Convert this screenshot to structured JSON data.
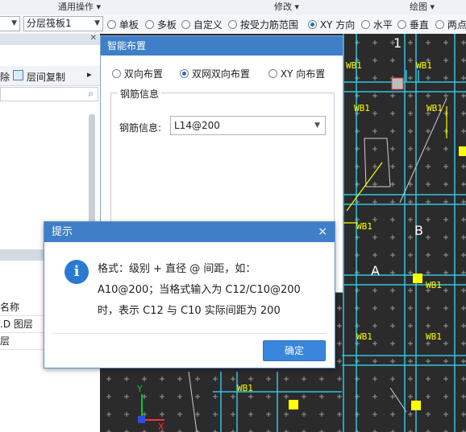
{
  "toolbar": {
    "group1": "通用操作",
    "group2": "修改",
    "group3": "绘图",
    "layer_combo": "分层筏板1",
    "options": [
      "单板",
      "多板",
      "自定义",
      "按受力筋范围",
      "XY 方向",
      "水平",
      "垂直",
      "两点"
    ],
    "selected_option": "XY 方向"
  },
  "left_panel": {
    "tool_delete": "除",
    "tool_copy": "层间复制",
    "column_header": "名称",
    "rows": [
      ".D 图层",
      "层"
    ]
  },
  "smart_dialog": {
    "title": "智能布置",
    "options": [
      "双向布置",
      "双网双向布置",
      "XY 向布置"
    ],
    "selected": "双网双向布置",
    "group_legend": "钢筋信息",
    "rebar_label": "钢筋信息:",
    "rebar_value": "L14@200"
  },
  "tip_dialog": {
    "title": "提示",
    "close_glyph": "×",
    "line1": "格式：级别 + 直径 @ 间距，如：",
    "line2": "A10@200；当格式输入为 C12/C10@200",
    "line3": "时，表示 C12 与 C10 实际间距为 200",
    "ok_label": "确定"
  },
  "canvas": {
    "labels": [
      "WB1",
      "WB1",
      "WB1",
      "WB1",
      "WB1",
      "WB1",
      "WB1",
      "WB1",
      "WB1"
    ],
    "mark_1": "1",
    "mark_A": "A",
    "mark_B": "B",
    "axis_x": "X",
    "axis_y": "Y"
  },
  "colors": {
    "dialog_title": "#3f7fc7",
    "ok_button": "#3a86dc",
    "canvas_bg": "#2b2b2b",
    "cad_yellow": "#ffff00",
    "cad_cyan": "#33c4e0"
  }
}
